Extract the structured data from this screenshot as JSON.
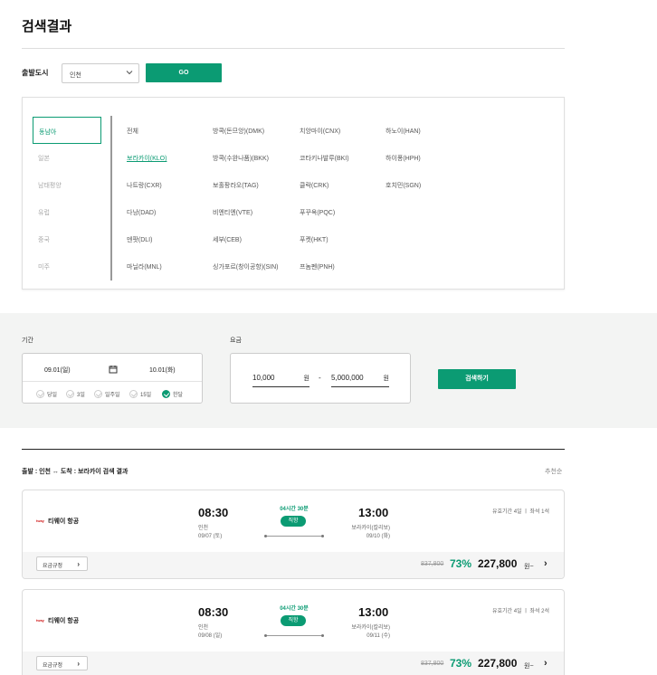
{
  "page": {
    "title": "검색결과"
  },
  "departure": {
    "label": "출발도시",
    "city": "인천",
    "go_label": "GO"
  },
  "regions": [
    {
      "label": "동남아",
      "active": true
    },
    {
      "label": "일본",
      "active": false
    },
    {
      "label": "남태평양",
      "active": false
    },
    {
      "label": "유럽",
      "active": false
    },
    {
      "label": "중국",
      "active": false
    },
    {
      "label": "미주",
      "active": false
    }
  ],
  "destinations": {
    "col1": [
      "전체",
      "보라카이(KLO)",
      "나트랑(CXR)",
      "다낭(DAD)",
      "덴팟(DLI)",
      "마닐라(MNL)"
    ],
    "col2": [
      "방콕(돈므앙)(DMK)",
      "방콕(수완나품)(BKK)",
      "보홀팡라오(TAG)",
      "비엔티엔(VTE)",
      "세부(CEB)",
      "싱가포르(창이공항)(SIN)"
    ],
    "col3": [
      "치앙마이(CNX)",
      "코타키나발루(BKI)",
      "클락(CRK)",
      "푸꾸옥(PQC)",
      "푸켓(HKT)",
      "프놈펜(PNH)"
    ],
    "col4": [
      "하노이(HAN)",
      "하이퐁(HPH)",
      "호치민(SGN)"
    ],
    "selected": "보라카이(KLO)"
  },
  "period": {
    "label": "기간",
    "start": "09.01(일)",
    "end": "10.01(화)",
    "options": [
      "당일",
      "3일",
      "일주일",
      "15일",
      "한달"
    ],
    "selected": "한달"
  },
  "price": {
    "label": "요금",
    "min": "10,000",
    "max": "5,000,000",
    "unit": "원",
    "separator": "-"
  },
  "search_label": "검색하기",
  "results": {
    "title": "출발 : 인천 ↔ 도착 : 보라카이 검색 결과",
    "sort": "추천순",
    "flights": [
      {
        "logo": "tway",
        "airline": "티웨이 항공",
        "dep_time": "08:30",
        "dep_city": "인천",
        "dep_date": "09/07 (토)",
        "duration": "04시간 30분",
        "direct": "직항",
        "arr_time": "13:00",
        "arr_city": "보라카이(칼리보)",
        "arr_date": "09/10 (화)",
        "validity": "유효기간 4일 ㅣ 좌석 1석",
        "fare_rule": "요금규정",
        "orig_price": "837,800",
        "discount": "73%",
        "price": "227,800",
        "won": "원~"
      },
      {
        "logo": "tway",
        "airline": "티웨이 항공",
        "dep_time": "08:30",
        "dep_city": "인천",
        "dep_date": "09/08 (일)",
        "duration": "04시간 30분",
        "direct": "직항",
        "arr_time": "13:00",
        "arr_city": "보라카이(칼리보)",
        "arr_date": "09/11 (수)",
        "validity": "유효기간 4일 ㅣ 좌석 2석",
        "fare_rule": "요금규정",
        "orig_price": "837,800",
        "discount": "73%",
        "price": "227,800",
        "won": "원~"
      }
    ]
  },
  "colors": {
    "accent": "#0b9b73",
    "band": "#f3f4f3"
  }
}
